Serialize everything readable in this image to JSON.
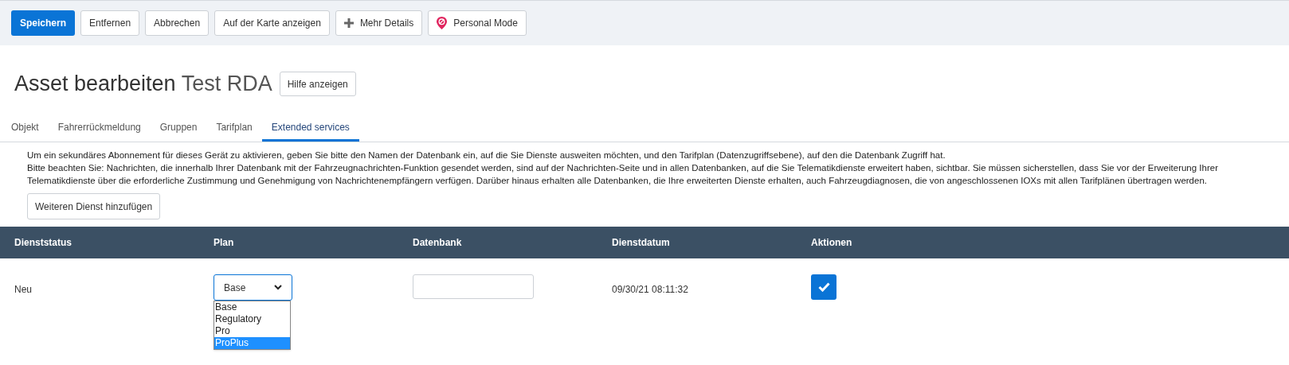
{
  "toolbar": {
    "buttons": [
      {
        "label": "Speichern",
        "kind": "primary"
      },
      {
        "label": "Entfernen",
        "kind": "plain"
      },
      {
        "label": "Abbrechen",
        "kind": "plain"
      },
      {
        "label": "Auf der Karte anzeigen",
        "kind": "plain"
      },
      {
        "label": "Mehr Details",
        "kind": "plus"
      },
      {
        "label": "Personal Mode",
        "kind": "pin"
      }
    ]
  },
  "heading": {
    "title": "Asset bearbeiten",
    "subject": "Test RDA",
    "help_button": "Hilfe anzeigen"
  },
  "tabs": [
    {
      "label": "Objekt",
      "selected": false
    },
    {
      "label": "Fahrerrückmeldung",
      "selected": false
    },
    {
      "label": "Gruppen",
      "selected": false
    },
    {
      "label": "Tarifplan",
      "selected": false
    },
    {
      "label": "Extended services",
      "selected": true
    }
  ],
  "info": [
    "Um ein sekundäres Abonnement für dieses Gerät zu aktivieren, geben Sie bitte den Namen der Datenbank ein, auf die Sie Dienste ausweiten möchten, und den Tarifplan (Datenzugriffsebene), auf den die Datenbank Zugriff hat.",
    "Bitte beachten Sie: Nachrichten, die innerhalb Ihrer Datenbank mit der Fahrzeugnachrichten-Funktion gesendet werden, sind auf der Nachrichten-Seite und in allen Datenbanken, auf die Sie Telematikdienste erweitert haben, sichtbar. Sie müssen sicherstellen, dass Sie vor der Erweiterung Ihrer Telematikdienste über die erforderliche Zustimmung und Genehmigung von Nachrichtenempfängern verfügen. Darüber hinaus erhalten alle Datenbanken, die Ihre erweiterten Dienste erhalten, auch Fahrzeugdiagnosen, die von angeschlossenen IOXs mit allen Tarifplänen übertragen werden."
  ],
  "add_button": "Weiteren Dienst hinzufügen",
  "table": {
    "columns": [
      "Dienststatus",
      "Plan",
      "Datenbank",
      "Dienstdatum",
      "Aktionen"
    ],
    "rows": [
      {
        "status": "Neu",
        "plan": "Base",
        "plan_options": [
          {
            "label": "Base",
            "selected": false
          },
          {
            "label": "Regulatory",
            "selected": false
          },
          {
            "label": "Pro",
            "selected": false
          },
          {
            "label": "ProPlus",
            "selected": true
          }
        ],
        "date": "09/30/21 08:11:32"
      }
    ]
  }
}
